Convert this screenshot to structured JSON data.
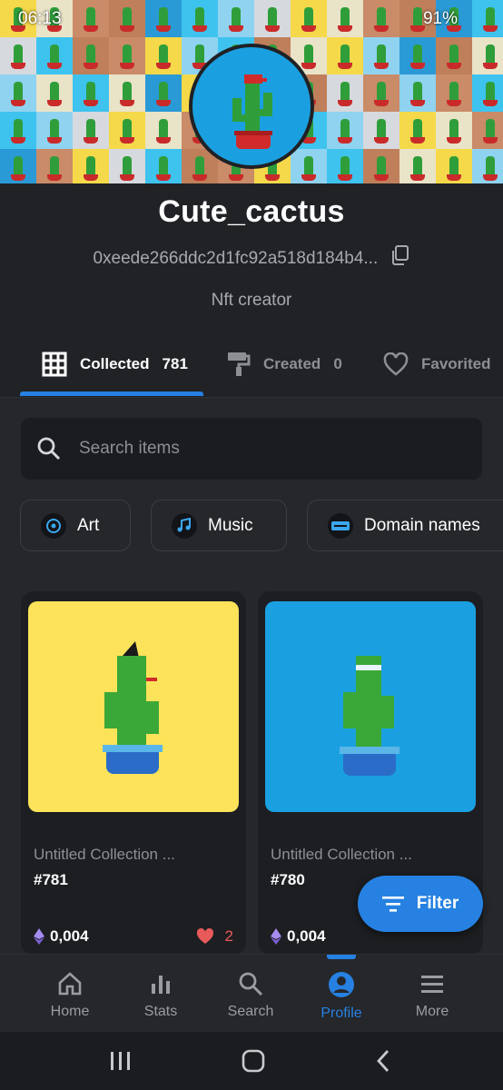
{
  "status_bar": {
    "time": "06:13",
    "battery": "91%"
  },
  "profile": {
    "name": "Cute_cactus",
    "address": "0xeede266ddc2d1fc92a518d184b4...",
    "bio": "Nft creator"
  },
  "tabs": [
    {
      "label": "Collected",
      "count": "781",
      "icon": "grid-icon"
    },
    {
      "label": "Created",
      "count": "0",
      "icon": "paint-roller-icon"
    },
    {
      "label": "Favorited",
      "icon": "heart-icon"
    }
  ],
  "search": {
    "placeholder": "Search items"
  },
  "categories": [
    {
      "label": "Art",
      "icon": "art-icon"
    },
    {
      "label": "Music",
      "icon": "music-icon"
    },
    {
      "label": "Domain names",
      "icon": "domain-icon"
    }
  ],
  "items": [
    {
      "collection": "Untitled Collection ...",
      "number": "#781",
      "price": "0,004",
      "likes": "2",
      "bg_color": "#fce35a"
    },
    {
      "collection": "Untitled Collection ...",
      "number": "#780",
      "price": "0,004",
      "bg_color": "#1aa0e0"
    }
  ],
  "filter_button": {
    "label": "Filter"
  },
  "bottom_nav": [
    {
      "label": "Home",
      "icon": "home-icon"
    },
    {
      "label": "Stats",
      "icon": "stats-icon"
    },
    {
      "label": "Search",
      "icon": "search-icon"
    },
    {
      "label": "Profile",
      "icon": "profile-icon"
    },
    {
      "label": "More",
      "icon": "menu-icon"
    }
  ],
  "colors": {
    "accent": "#2681e2",
    "background": "#202225",
    "card": "#1c1e21",
    "like": "#e85a5a"
  }
}
